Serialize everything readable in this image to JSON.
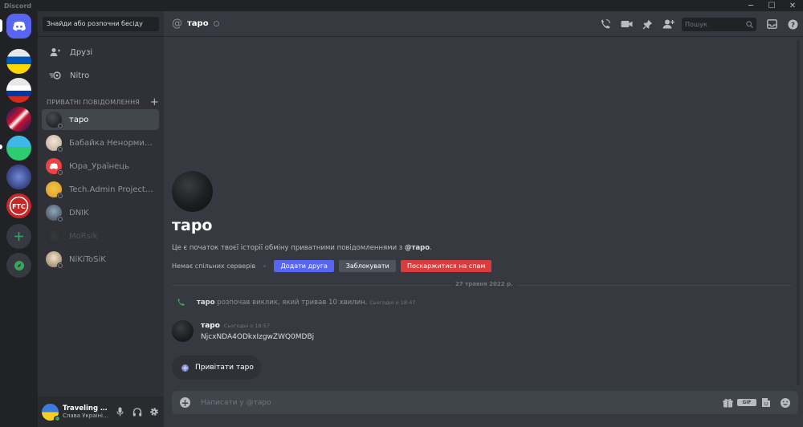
{
  "app": {
    "title": "Discord"
  },
  "window": {
    "minimize": "─",
    "maximize": "☐",
    "close": "✕"
  },
  "sidebar": {
    "search_placeholder": "Знайди або розпочни бесіду",
    "nav": [
      {
        "label": "Друзі",
        "icon": "friends-icon"
      },
      {
        "label": "Nitro",
        "icon": "nitro-icon"
      }
    ],
    "dm_header": "ПРИВАТНІ ПОВІДОМЛЕННЯ",
    "dms": [
      {
        "name": "таро",
        "active": true
      },
      {
        "name": "Бабайка Ненормирно..."
      },
      {
        "name": "Юра_Ураїнець"
      },
      {
        "name": "Tech.Admin Project Vi..."
      },
      {
        "name": "DNIK"
      },
      {
        "name": "MoRsik",
        "dim": true
      },
      {
        "name": "NiKiToSiK"
      }
    ]
  },
  "user": {
    "name": "Traveling Tr...",
    "status": "Слава Україні!..."
  },
  "channel": {
    "at": "@",
    "name": "таро"
  },
  "header": {
    "search_placeholder": "Пошук"
  },
  "intro": {
    "name": "таро",
    "desc_prefix": "Це є початок твоєї історії обміну приватними повідомленнями з ",
    "desc_user": "@таро",
    "desc_suffix": ".",
    "no_mutual": "Немає спільних серверів",
    "add_friend": "Додати друга",
    "block": "Заблокувати",
    "report": "Поскаржитися на спам"
  },
  "date_divider": "27 травня 2022 р.",
  "call": {
    "author": "таро",
    "text": " розпочав виклик, який тривав 10 хвилин.",
    "time": "Сьогодні о 18:47"
  },
  "message": {
    "author": "таро",
    "time": "Сьогодні о 18:57",
    "text": "NjcxNDA4ODkxIzgwZWQ0MDBj"
  },
  "wave_label": "Привітати таро",
  "composer": {
    "placeholder": "Написати у @таро",
    "gif": "GIF"
  },
  "colors": {
    "blurple": "#5865f2",
    "red": "#d83c3e",
    "green": "#3ba55d",
    "bg": "#36393f"
  }
}
